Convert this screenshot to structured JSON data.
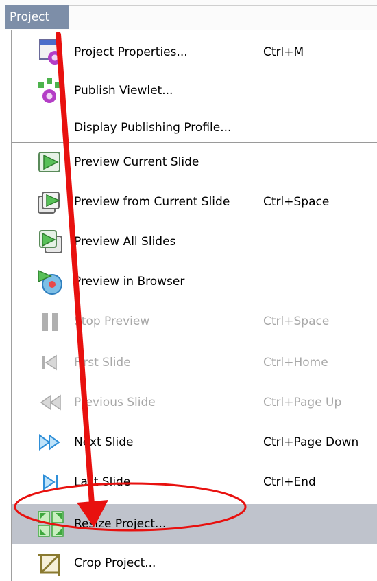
{
  "menubar": {
    "title": "Project"
  },
  "items": [
    {
      "label": "Project Properties...",
      "shortcut": "Ctrl+M",
      "icon": "project-properties-icon",
      "enabled": true
    },
    {
      "label": "Publish Viewlet...",
      "shortcut": "",
      "icon": "publish-viewlet-icon",
      "enabled": true
    },
    {
      "label": "Display Publishing Profile...",
      "shortcut": "",
      "icon": "",
      "enabled": true
    },
    {
      "label": "Preview Current Slide",
      "shortcut": "",
      "icon": "preview-current-slide-icon",
      "enabled": true
    },
    {
      "label": "Preview from Current Slide",
      "shortcut": "Ctrl+Space",
      "icon": "preview-from-current-slide-icon",
      "enabled": true
    },
    {
      "label": "Preview All Slides",
      "shortcut": "",
      "icon": "preview-all-slides-icon",
      "enabled": true
    },
    {
      "label": "Preview in Browser",
      "shortcut": "",
      "icon": "preview-in-browser-icon",
      "enabled": true
    },
    {
      "label": "Stop Preview",
      "shortcut": "Ctrl+Space",
      "icon": "stop-preview-icon",
      "enabled": false
    },
    {
      "label": "First Slide",
      "shortcut": "Ctrl+Home",
      "icon": "first-slide-icon",
      "enabled": false
    },
    {
      "label": "Previous Slide",
      "shortcut": "Ctrl+Page Up",
      "icon": "previous-slide-icon",
      "enabled": false
    },
    {
      "label": "Next Slide",
      "shortcut": "Ctrl+Page Down",
      "icon": "next-slide-icon",
      "enabled": true
    },
    {
      "label": "Last Slide",
      "shortcut": "Ctrl+End",
      "icon": "last-slide-icon",
      "enabled": true
    },
    {
      "label": "Resize Project...",
      "shortcut": "",
      "icon": "resize-project-icon",
      "enabled": true,
      "highlighted": true
    },
    {
      "label": "Crop Project...",
      "shortcut": "",
      "icon": "crop-project-icon",
      "enabled": true
    }
  ],
  "colors": {
    "highlight": "#bfc3cc",
    "menubar_active": "#7d8ea8",
    "annotation": "#e8110f",
    "disabled_text": "#a8a8a8"
  }
}
